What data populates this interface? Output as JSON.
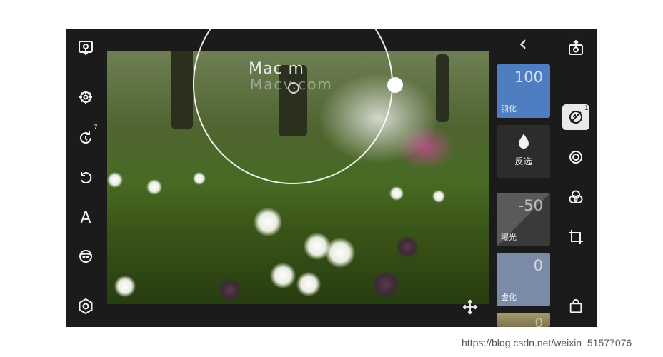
{
  "left_toolbar": {
    "items": [
      {
        "name": "export-icon"
      },
      {
        "name": "presets-icon"
      },
      {
        "name": "history-icon",
        "badge": "7"
      },
      {
        "name": "undo-icon"
      },
      {
        "name": "text-tool-icon",
        "glyph": "A"
      },
      {
        "name": "portrait-icon"
      },
      {
        "name": "settings-hexagon-icon"
      }
    ]
  },
  "canvas": {
    "watermark_line1": "Mac  m",
    "watermark_line2": "Macv.com"
  },
  "mask_panel": {
    "back_glyph": "‹",
    "feather": {
      "value": "100",
      "label": "羽化"
    },
    "invert": {
      "label": "反选"
    },
    "exposure": {
      "value": "-50",
      "label": "曝光"
    },
    "blur": {
      "value": "0",
      "label": "虚化"
    },
    "extra": {
      "value": "0"
    }
  },
  "right_toolbar": {
    "items": [
      {
        "name": "share-icon"
      },
      {
        "name": "mask-tool-icon",
        "badge": "1",
        "active": true
      },
      {
        "name": "radial-mask-icon"
      },
      {
        "name": "color-mix-icon"
      },
      {
        "name": "crop-icon"
      },
      {
        "name": "bag-icon"
      }
    ]
  },
  "move_icon": "move-icon",
  "footer_watermark": "https://blog.csdn.net/weixin_51577076",
  "colors": {
    "feather_panel": "#4e7dc1",
    "frame_bg": "#1b1b1b"
  }
}
